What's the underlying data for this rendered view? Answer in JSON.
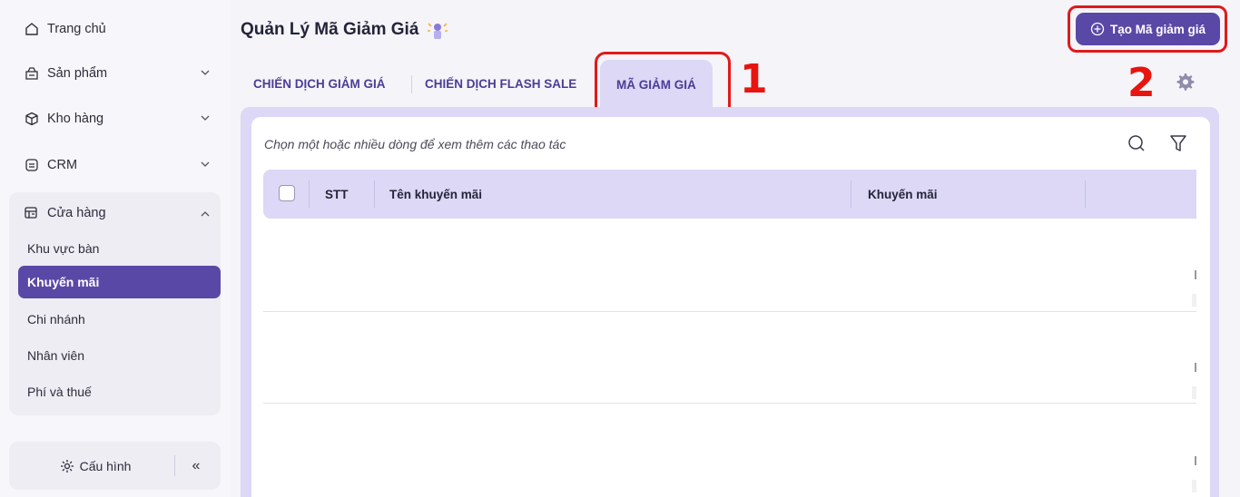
{
  "sidebar": {
    "items": [
      {
        "label": "Trang chủ",
        "icon": "home-icon"
      },
      {
        "label": "Sản phẩm",
        "icon": "product-icon"
      },
      {
        "label": "Kho hàng",
        "icon": "warehouse-icon"
      },
      {
        "label": "CRM",
        "icon": "crm-icon"
      }
    ],
    "store": {
      "label": "Cửa hàng",
      "icon": "store-icon",
      "subitems": [
        "Khu vực bàn",
        "Khuyến mãi",
        "Chi nhánh",
        "Nhân viên",
        "Phí và thuế"
      ],
      "active_subitem": "Khuyến mãi"
    },
    "config_label": "Cấu hình",
    "collapse_label": "«"
  },
  "header": {
    "title": "Quản Lý Mã Giảm Giá",
    "create_button_label": "Tạo Mã giảm giá"
  },
  "tabs": [
    {
      "label": "CHIẾN DỊCH GIẢM GIÁ",
      "active": false
    },
    {
      "label": "CHIẾN DỊCH FLASH SALE",
      "active": false
    },
    {
      "label": "MÃ GIẢM GIÁ",
      "active": true
    }
  ],
  "annotations": {
    "first": "1",
    "second": "2"
  },
  "table": {
    "hint": "Chọn một hoặc nhiều dòng để xem thêm các thao tác",
    "columns": [
      "STT",
      "Tên khuyến mãi",
      "Khuyến mãi"
    ]
  },
  "colors": {
    "accent": "#5a48a6",
    "tab_active_bg": "#dcd8f6",
    "annotation_red": "#e01a1a"
  }
}
